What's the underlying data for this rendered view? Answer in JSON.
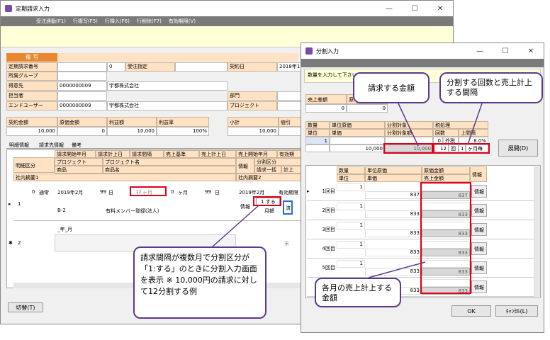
{
  "main": {
    "title": "定期請求入力",
    "menu": [
      "受注連動(F1)",
      "行複写(F5)",
      "行挿入(F6)",
      "行削除(F7)",
      "有効期限(V)"
    ],
    "header_title": "複 写",
    "fields": [
      {
        "label": "定期請求番号",
        "value": "",
        "value2": "0",
        "label2": "受注指定",
        "label3": "契約日",
        "value3": "2018年1"
      },
      {
        "label": "所属グループ",
        "value": ""
      },
      {
        "label": "得意先",
        "value": "0000000009",
        "name": "宇都株式会社"
      },
      {
        "label": "担当者",
        "value": "",
        "label3": "部門"
      },
      {
        "label": "エンドユーザー",
        "value": "0000000009",
        "name": "宇都株式会社",
        "label3": "プロジェクト"
      }
    ],
    "totals_headers": [
      "契約金額",
      "原価金額",
      "利益額",
      "利益率",
      "小計",
      "値引"
    ],
    "totals_values": [
      "10,000",
      "0",
      "10,000",
      "100%",
      "10,000",
      ""
    ],
    "tabs": [
      "明細情報",
      "請求先情報",
      "備考"
    ],
    "grid_headers_row1": [
      "請求開始年月",
      "請求計上日",
      "請求間隔",
      "売上基準",
      "売上計上日",
      "売上開始年月",
      "有効期"
    ],
    "grid_headers_row2": [
      "プロジェクト",
      "プロジェクト名",
      "分割区分"
    ],
    "grid_headers_row3": [
      "商品",
      "商品名",
      "請求一括",
      "計上"
    ],
    "grid_headers_row4": [
      "社内摘要1",
      "社内摘要2"
    ],
    "col_meisai": "明細区分",
    "col_info": "情報",
    "row1": {
      "no": "1",
      "num": "0",
      "kubun": "通常",
      "start": "2019年2月",
      "day": "99",
      "day_unit": "日",
      "interval": "12",
      "interval_unit": "ヶ月",
      "kijun": "0",
      "kijun_unit": "ヶ月",
      "uday": "99",
      "uday_unit": "日",
      "ustart": "2019年2月",
      "yuko": "有効期限",
      "info": "情報",
      "split": "1",
      "split_label": "する",
      "sumi": "済",
      "getsu": "月額",
      "code": "B-2",
      "item": "有料メンバー登録(法人)"
    },
    "row2": {
      "no": "2",
      "start": "_年_月",
      "unit_hint": "末"
    },
    "toggle_button": "切替(T)"
  },
  "dialog": {
    "title": "分割入力",
    "instruction": "数量を入力して下さい",
    "summary_headers": [
      "売上差額",
      "原"
    ],
    "summary_values": [
      "0",
      "0"
    ],
    "table_headers_r1": [
      "数量",
      "単位原価",
      "分割対象",
      "税処理"
    ],
    "table_headers_r2": [
      "単位",
      "単価",
      "分割対象額",
      "回数",
      "上間隔"
    ],
    "tax_value": "0",
    "tax_label": "外税",
    "tax_rate": "8.0%",
    "qty": "1",
    "price": "10,000",
    "target": "10,000",
    "times": "12",
    "times_unit": "回",
    "interval": "1",
    "interval_unit": "ヶ月毎",
    "expand_button": "展開(D)",
    "list_headers_r1": [
      "数量",
      "単位原価",
      "原価金額",
      "情報"
    ],
    "list_headers_r2": [
      "単位",
      "単価",
      "売上金額"
    ],
    "rows": [
      {
        "label": "1回目",
        "qty": "1",
        "price": "837",
        "amount": "837",
        "info": "情報"
      },
      {
        "label": "2回目",
        "qty": "1",
        "price": "833",
        "amount": "833",
        "info": "情報"
      },
      {
        "label": "3回目",
        "qty": "1",
        "price": "833",
        "amount": "833",
        "info": "情報"
      },
      {
        "label": "4回目",
        "qty": "1",
        "price": "833",
        "amount": "833",
        "info": "情報"
      },
      {
        "label": "5回目",
        "qty": "1",
        "price": "833",
        "amount": "833",
        "info": "情報"
      },
      {
        "label": "6回目",
        "qty": "1",
        "price": "833",
        "amount": "833",
        "info": "情報"
      }
    ],
    "ok": "OK",
    "cancel": "ｷｬﾝｾﾙ(L)"
  },
  "callouts": {
    "amount": "請求する金額",
    "split": "分割する回数と売上計上する間隔",
    "main": "請求間隔が複数月で分割区分が「1:する」のときに分割入力画面を表示 ※ 10,000円の請求に対して12分割する例",
    "monthly": "各月の売上計上する金額"
  }
}
